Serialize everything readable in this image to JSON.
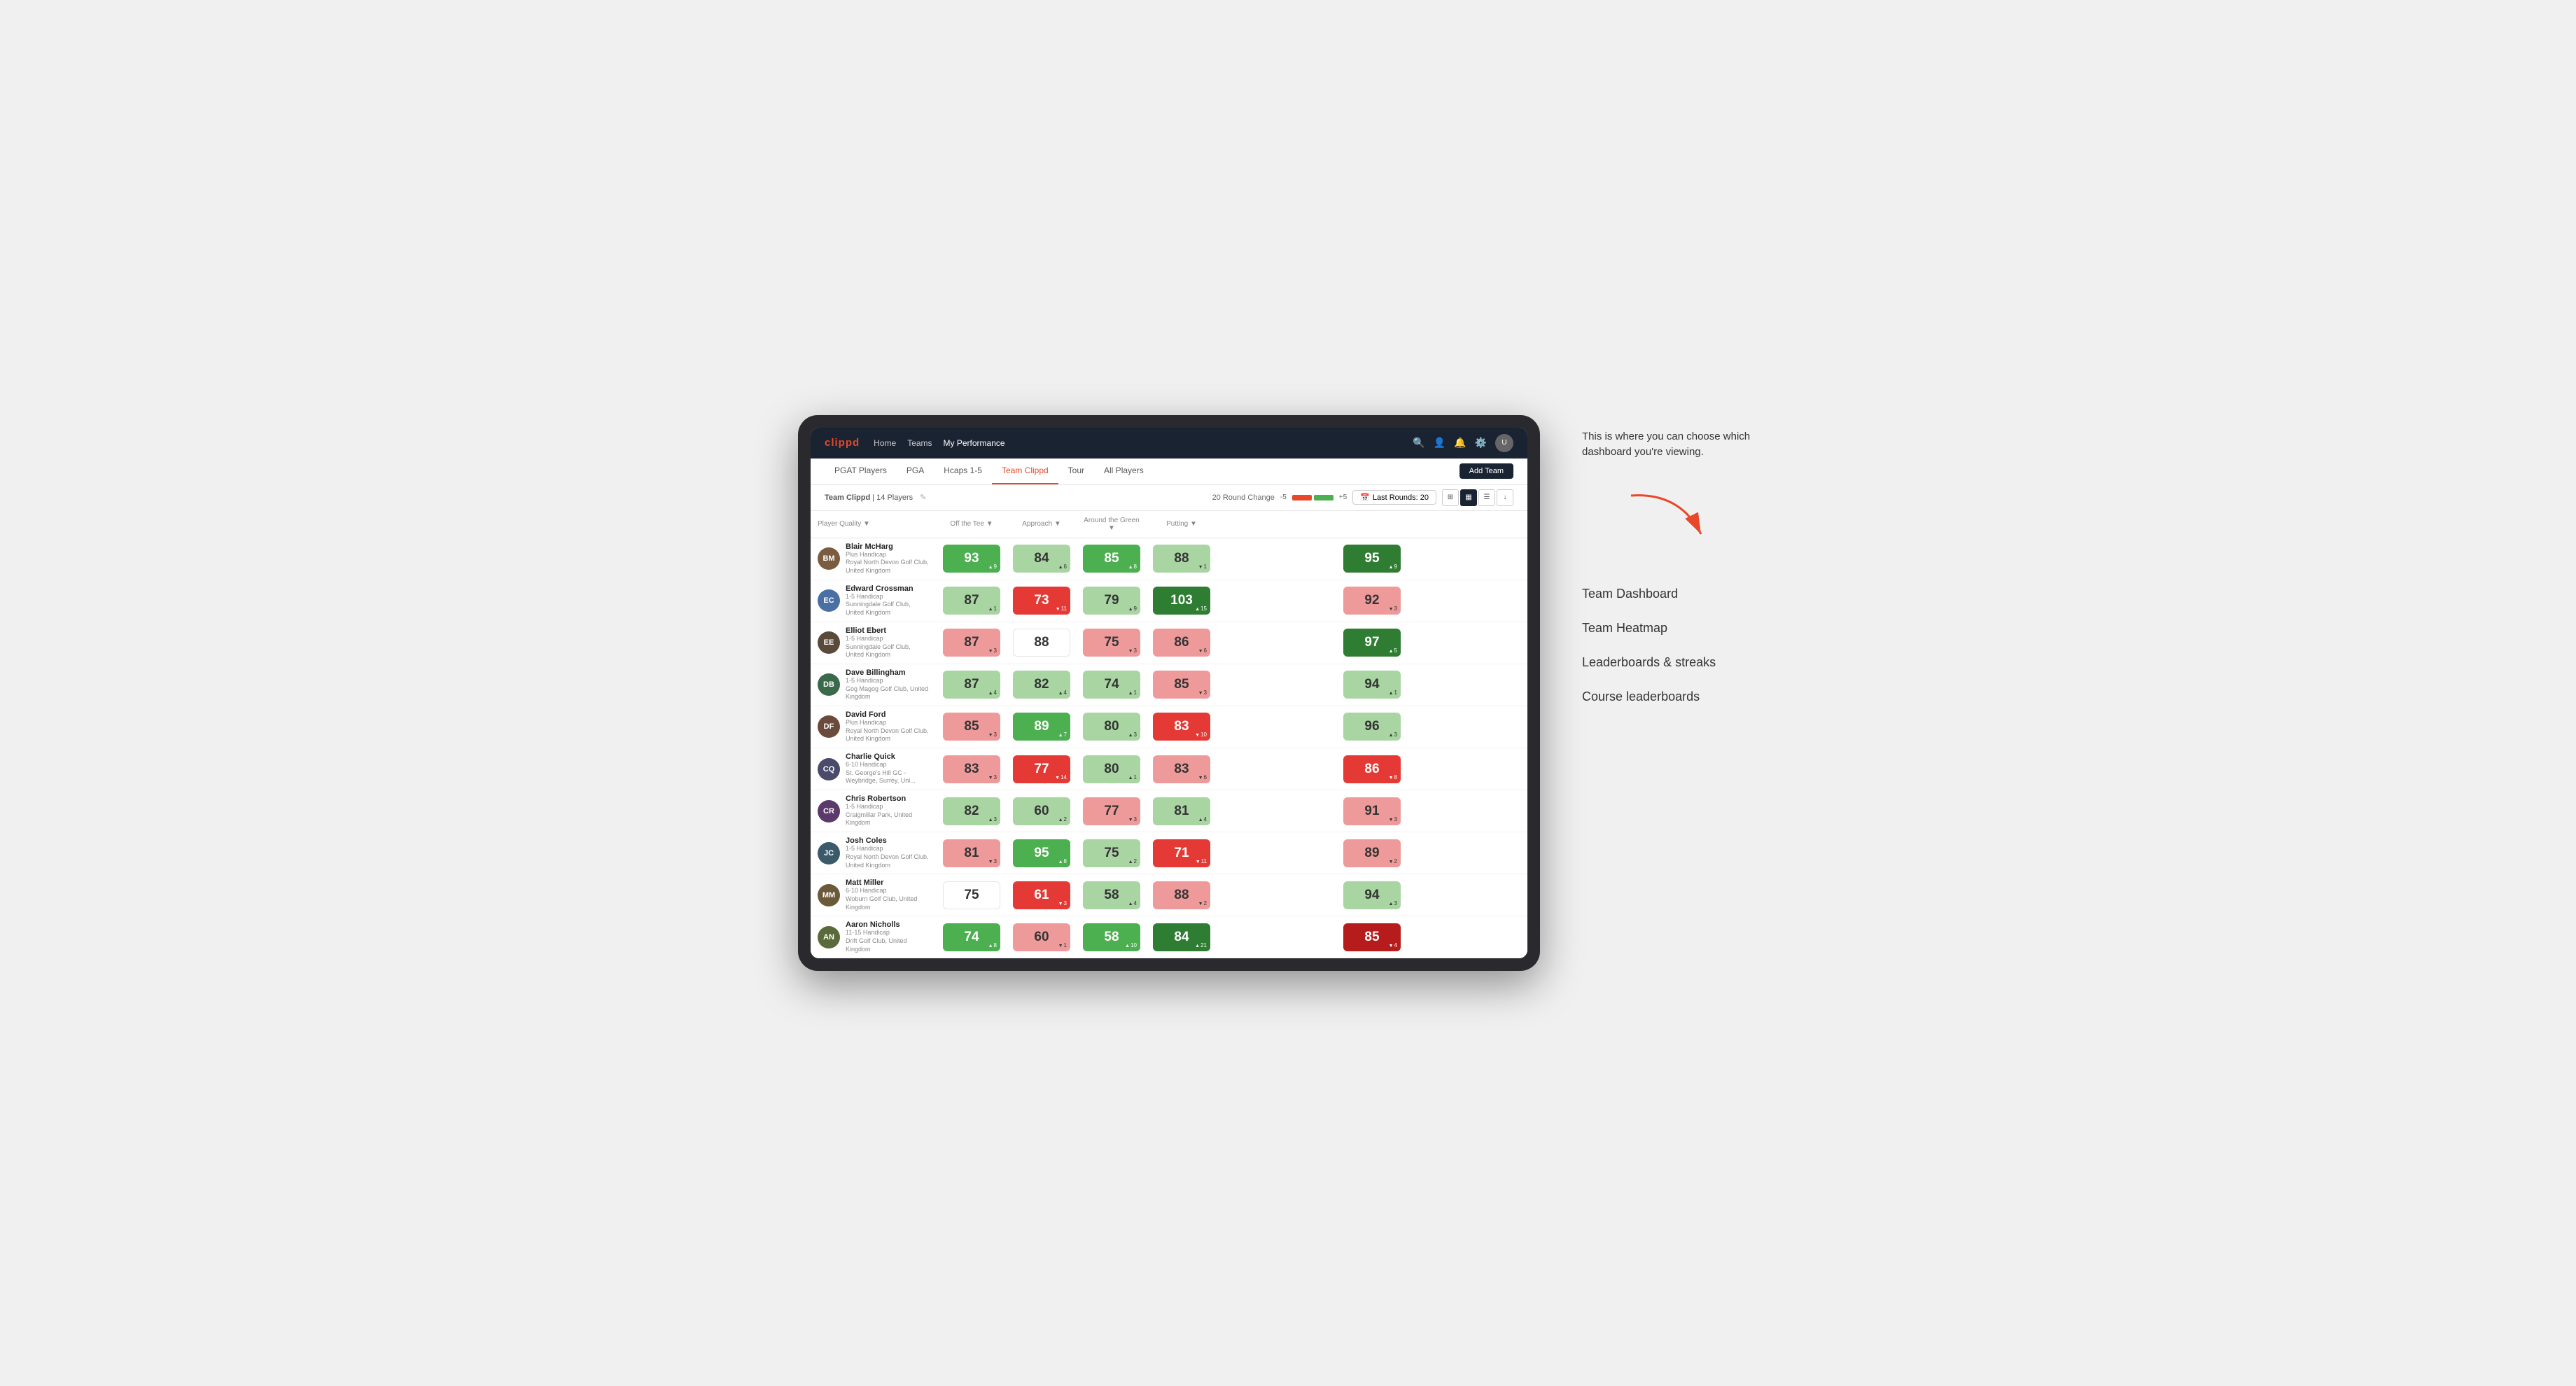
{
  "annotation": {
    "intro_text": "This is where you can choose which dashboard you're viewing.",
    "dashboard_items": [
      "Team Dashboard",
      "Team Heatmap",
      "Leaderboards & streaks",
      "Course leaderboards"
    ]
  },
  "nav": {
    "logo": "clippd",
    "links": [
      "Home",
      "Teams",
      "My Performance"
    ],
    "active_link": "My Performance"
  },
  "tabs": {
    "items": [
      "PGAT Players",
      "PGA",
      "Hcaps 1-5",
      "Team Clippd",
      "Tour",
      "All Players"
    ],
    "active": "Team Clippd",
    "add_button": "Add Team"
  },
  "sub_bar": {
    "team_name": "Team Clippd",
    "player_count": "14 Players",
    "round_change_label": "20 Round Change",
    "neg_value": "-5",
    "pos_value": "+5",
    "last_rounds_label": "Last Rounds:",
    "last_rounds_value": "20"
  },
  "table": {
    "headers": [
      "Player Quality ▼",
      "Off the Tee ▼",
      "Approach ▼",
      "Around the Green ▼",
      "Putting ▼"
    ],
    "rows": [
      {
        "name": "Blair McHarg",
        "handicap": "Plus Handicap",
        "club": "Royal North Devon Golf Club, United Kingdom",
        "scores": [
          {
            "value": "93",
            "delta": "9",
            "dir": "up",
            "color": "green"
          },
          {
            "value": "84",
            "delta": "6",
            "dir": "up",
            "color": "green-light"
          },
          {
            "value": "85",
            "delta": "8",
            "dir": "up",
            "color": "green"
          },
          {
            "value": "88",
            "delta": "1",
            "dir": "down",
            "color": "green-light"
          },
          {
            "value": "95",
            "delta": "9",
            "dir": "up",
            "color": "green-dark"
          }
        ]
      },
      {
        "name": "Edward Crossman",
        "handicap": "1-5 Handicap",
        "club": "Sunningdale Golf Club, United Kingdom",
        "scores": [
          {
            "value": "87",
            "delta": "1",
            "dir": "up",
            "color": "green-light"
          },
          {
            "value": "73",
            "delta": "11",
            "dir": "down",
            "color": "red"
          },
          {
            "value": "79",
            "delta": "9",
            "dir": "up",
            "color": "green-light"
          },
          {
            "value": "103",
            "delta": "15",
            "dir": "up",
            "color": "green-dark"
          },
          {
            "value": "92",
            "delta": "3",
            "dir": "down",
            "color": "red-light"
          }
        ]
      },
      {
        "name": "Elliot Ebert",
        "handicap": "1-5 Handicap",
        "club": "Sunningdale Golf Club, United Kingdom",
        "scores": [
          {
            "value": "87",
            "delta": "3",
            "dir": "down",
            "color": "red-light"
          },
          {
            "value": "88",
            "delta": "",
            "dir": "",
            "color": "white"
          },
          {
            "value": "75",
            "delta": "3",
            "dir": "down",
            "color": "red-light"
          },
          {
            "value": "86",
            "delta": "6",
            "dir": "down",
            "color": "red-light"
          },
          {
            "value": "97",
            "delta": "5",
            "dir": "up",
            "color": "green-dark"
          }
        ]
      },
      {
        "name": "Dave Billingham",
        "handicap": "1-5 Handicap",
        "club": "Gog Magog Golf Club, United Kingdom",
        "scores": [
          {
            "value": "87",
            "delta": "4",
            "dir": "up",
            "color": "green-light"
          },
          {
            "value": "82",
            "delta": "4",
            "dir": "up",
            "color": "green-light"
          },
          {
            "value": "74",
            "delta": "1",
            "dir": "up",
            "color": "green-light"
          },
          {
            "value": "85",
            "delta": "3",
            "dir": "down",
            "color": "red-light"
          },
          {
            "value": "94",
            "delta": "1",
            "dir": "up",
            "color": "green-light"
          }
        ]
      },
      {
        "name": "David Ford",
        "handicap": "Plus Handicap",
        "club": "Royal North Devon Golf Club, United Kingdom",
        "scores": [
          {
            "value": "85",
            "delta": "3",
            "dir": "down",
            "color": "red-light"
          },
          {
            "value": "89",
            "delta": "7",
            "dir": "up",
            "color": "green"
          },
          {
            "value": "80",
            "delta": "3",
            "dir": "up",
            "color": "green-light"
          },
          {
            "value": "83",
            "delta": "10",
            "dir": "down",
            "color": "red"
          },
          {
            "value": "96",
            "delta": "3",
            "dir": "up",
            "color": "green-light"
          }
        ]
      },
      {
        "name": "Charlie Quick",
        "handicap": "6-10 Handicap",
        "club": "St. George's Hill GC - Weybridge, Surrey, Uni...",
        "scores": [
          {
            "value": "83",
            "delta": "3",
            "dir": "down",
            "color": "red-light"
          },
          {
            "value": "77",
            "delta": "14",
            "dir": "down",
            "color": "red"
          },
          {
            "value": "80",
            "delta": "1",
            "dir": "up",
            "color": "green-light"
          },
          {
            "value": "83",
            "delta": "6",
            "dir": "down",
            "color": "red-light"
          },
          {
            "value": "86",
            "delta": "8",
            "dir": "down",
            "color": "red"
          }
        ]
      },
      {
        "name": "Chris Robertson",
        "handicap": "1-5 Handicap",
        "club": "Craigmillar Park, United Kingdom",
        "scores": [
          {
            "value": "82",
            "delta": "3",
            "dir": "up",
            "color": "green-light"
          },
          {
            "value": "60",
            "delta": "2",
            "dir": "up",
            "color": "green-light"
          },
          {
            "value": "77",
            "delta": "3",
            "dir": "down",
            "color": "red-light"
          },
          {
            "value": "81",
            "delta": "4",
            "dir": "up",
            "color": "green-light"
          },
          {
            "value": "91",
            "delta": "3",
            "dir": "down",
            "color": "red-light"
          }
        ]
      },
      {
        "name": "Josh Coles",
        "handicap": "1-5 Handicap",
        "club": "Royal North Devon Golf Club, United Kingdom",
        "scores": [
          {
            "value": "81",
            "delta": "3",
            "dir": "down",
            "color": "red-light"
          },
          {
            "value": "95",
            "delta": "8",
            "dir": "up",
            "color": "green"
          },
          {
            "value": "75",
            "delta": "2",
            "dir": "up",
            "color": "green-light"
          },
          {
            "value": "71",
            "delta": "11",
            "dir": "down",
            "color": "red"
          },
          {
            "value": "89",
            "delta": "2",
            "dir": "down",
            "color": "red-light"
          }
        ]
      },
      {
        "name": "Matt Miller",
        "handicap": "6-10 Handicap",
        "club": "Woburn Golf Club, United Kingdom",
        "scores": [
          {
            "value": "75",
            "delta": "",
            "dir": "",
            "color": "white"
          },
          {
            "value": "61",
            "delta": "3",
            "dir": "down",
            "color": "red"
          },
          {
            "value": "58",
            "delta": "4",
            "dir": "up",
            "color": "green-light"
          },
          {
            "value": "88",
            "delta": "2",
            "dir": "down",
            "color": "red-light"
          },
          {
            "value": "94",
            "delta": "3",
            "dir": "up",
            "color": "green-light"
          }
        ]
      },
      {
        "name": "Aaron Nicholls",
        "handicap": "11-15 Handicap",
        "club": "Drift Golf Club, United Kingdom",
        "scores": [
          {
            "value": "74",
            "delta": "8",
            "dir": "up",
            "color": "green"
          },
          {
            "value": "60",
            "delta": "1",
            "dir": "down",
            "color": "red-light"
          },
          {
            "value": "58",
            "delta": "10",
            "dir": "up",
            "color": "green"
          },
          {
            "value": "84",
            "delta": "21",
            "dir": "up",
            "color": "green-dark"
          },
          {
            "value": "85",
            "delta": "4",
            "dir": "down",
            "color": "red-dark"
          }
        ]
      }
    ]
  },
  "colors": {
    "brand_red": "#e8472a",
    "nav_bg": "#1a2332",
    "green_dark": "#2e7d32",
    "green": "#4caf50",
    "green_light": "#a8d5a2",
    "red_dark": "#b71c1c",
    "red": "#e53935",
    "red_light": "#ef9a9a"
  },
  "avatar_initials": {
    "Blair McHarg": "BM",
    "Edward Crossman": "EC",
    "Elliot Ebert": "EE",
    "Dave Billingham": "DB",
    "David Ford": "DF",
    "Charlie Quick": "CQ",
    "Chris Robertson": "CR",
    "Josh Coles": "JC",
    "Matt Miller": "MM",
    "Aaron Nicholls": "AN"
  },
  "avatar_colors": {
    "Blair McHarg": "#7a5c40",
    "Edward Crossman": "#4a6fa5",
    "Elliot Ebert": "#5a4a3a",
    "Dave Billingham": "#3a6a4a",
    "David Ford": "#6a4a3a",
    "Charlie Quick": "#4a4a6a",
    "Chris Robertson": "#5a3a6a",
    "Josh Coles": "#3a5a6a",
    "Matt Miller": "#6a5a3a",
    "Aaron Nicholls": "#5a6a3a"
  }
}
